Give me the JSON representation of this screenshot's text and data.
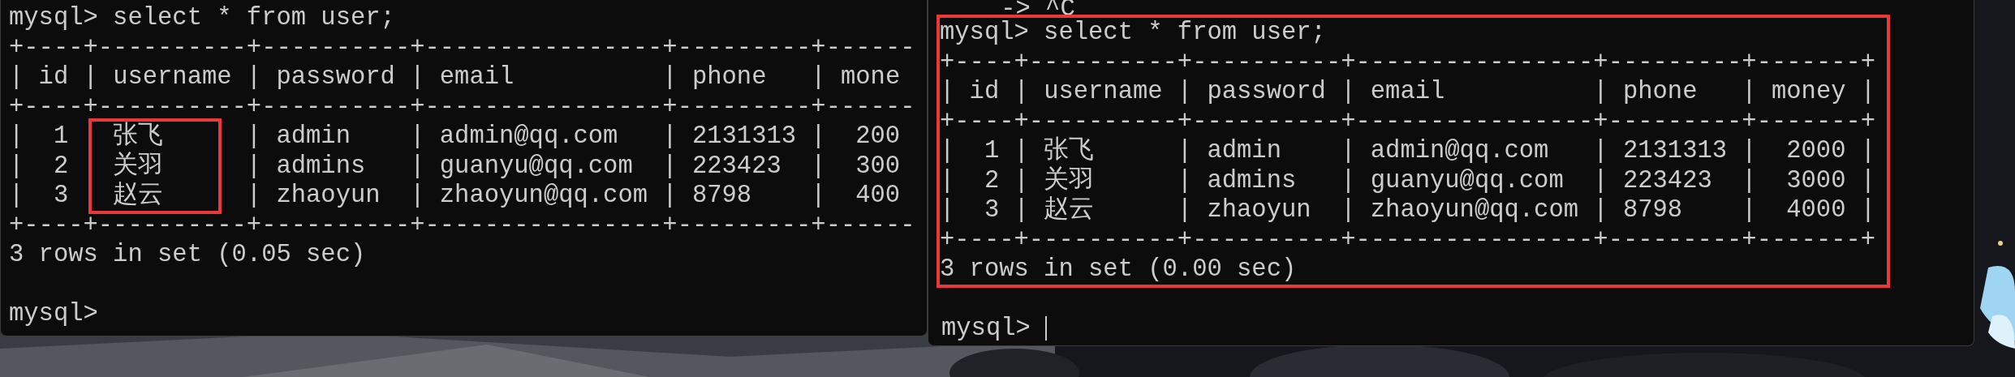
{
  "terminals": [
    {
      "highlighted": false,
      "command": "mysql> select * from user;",
      "table": {
        "border": "+----+----------+----------+----------------+---------+------",
        "separator": "|",
        "columns": [
          {
            "label": "id",
            "kind": "number",
            "highlighted": false
          },
          {
            "label": "username",
            "kind": "text",
            "highlighted": true
          },
          {
            "label": "password",
            "kind": "text",
            "highlighted": false
          },
          {
            "label": "email",
            "kind": "text",
            "highlighted": false
          },
          {
            "label": "phone",
            "kind": "text",
            "highlighted": false
          },
          {
            "label": "mone",
            "kind": "number",
            "highlighted": false
          }
        ],
        "rows": [
          [
            "1",
            "张飞",
            "admin",
            "admin@qq.com",
            "2131313",
            "200"
          ],
          [
            "2",
            "关羽",
            "admins",
            "guanyu@qq.com",
            "223423",
            "300"
          ],
          [
            "3",
            "赵云",
            "zhaoyun",
            "zhaoyun@qq.com",
            "8798",
            "400"
          ]
        ]
      },
      "result": "3 rows in set (0.05 sec)",
      "prompt": "mysql>",
      "cursor": false
    },
    {
      "highlighted": true,
      "pre_lines": [
        "    -> ^C"
      ],
      "command": "mysql> select * from user;",
      "table": {
        "border": "+----+----------+----------+----------------+---------+-------+",
        "separator": "|",
        "columns": [
          {
            "label": "id",
            "kind": "number",
            "highlighted": false
          },
          {
            "label": "username",
            "kind": "text",
            "highlighted": false
          },
          {
            "label": "password",
            "kind": "text",
            "highlighted": false
          },
          {
            "label": "email",
            "kind": "text",
            "highlighted": false
          },
          {
            "label": "phone",
            "kind": "text",
            "highlighted": false
          },
          {
            "label": "money",
            "kind": "number",
            "highlighted": false
          }
        ],
        "rows": [
          [
            "1",
            "张飞",
            "admin",
            "admin@qq.com",
            "2131313",
            "2000"
          ],
          [
            "2",
            "关羽",
            "admins",
            "guanyu@qq.com",
            "223423",
            "3000"
          ],
          [
            "3",
            "赵云",
            "zhaoyun",
            "zhaoyun@qq.com",
            "8798",
            "4000"
          ]
        ]
      },
      "result": "3 rows in set (0.00 sec)",
      "prompt": "mysql>",
      "cursor": true
    }
  ]
}
